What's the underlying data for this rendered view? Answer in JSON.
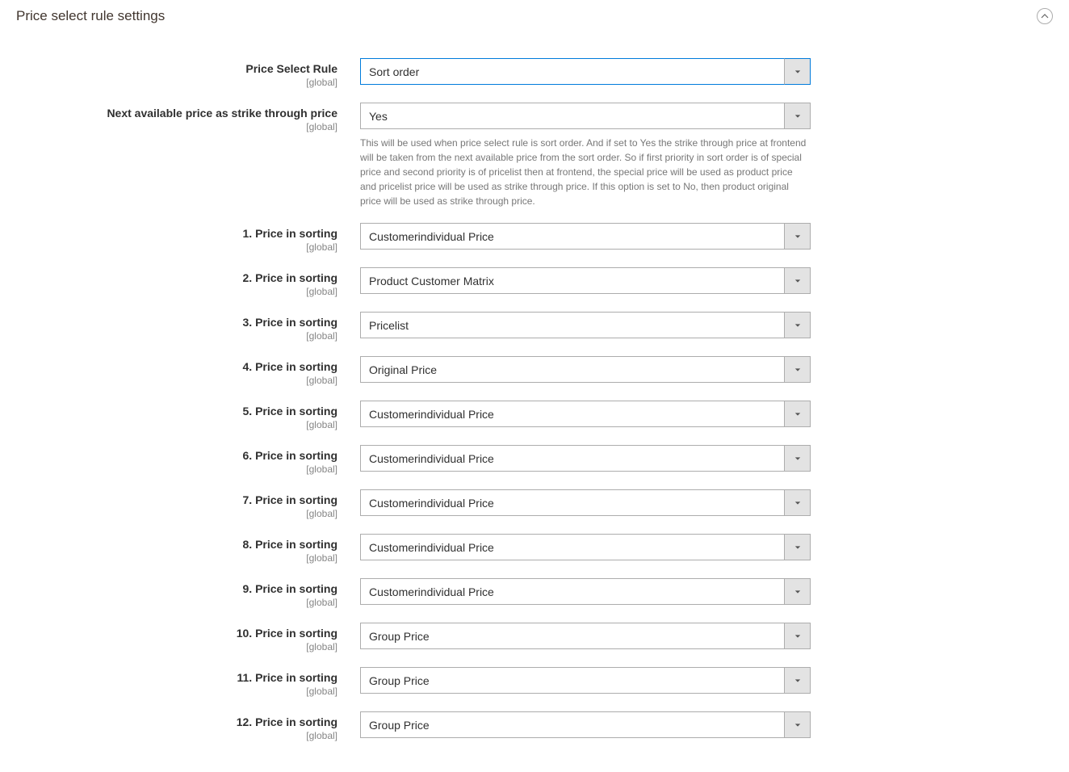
{
  "section": {
    "title": "Price select rule settings"
  },
  "scope": "[global]",
  "fields": {
    "price_select_rule": {
      "label": "Price Select Rule",
      "value": "Sort order"
    },
    "strike_through": {
      "label": "Next available price as strike through price",
      "value": "Yes",
      "help": "This will be used when price select rule is sort order. And if set to Yes the strike through price at frontend will be taken from the next available price from the sort order. So if first priority in sort order is of special price and second priority is of pricelist then at frontend, the special price will be used as product price and pricelist price will be used as strike through price. If this option is set to No, then product original price will be used as strike through price."
    },
    "sorting": [
      {
        "label": "1. Price in sorting",
        "value": "Customerindividual Price"
      },
      {
        "label": "2. Price in sorting",
        "value": "Product Customer Matrix"
      },
      {
        "label": "3. Price in sorting",
        "value": "Pricelist"
      },
      {
        "label": "4. Price in sorting",
        "value": "Original Price"
      },
      {
        "label": "5. Price in sorting",
        "value": "Customerindividual Price"
      },
      {
        "label": "6. Price in sorting",
        "value": "Customerindividual Price"
      },
      {
        "label": "7. Price in sorting",
        "value": "Customerindividual Price"
      },
      {
        "label": "8. Price in sorting",
        "value": "Customerindividual Price"
      },
      {
        "label": "9. Price in sorting",
        "value": "Customerindividual Price"
      },
      {
        "label": "10. Price in sorting",
        "value": "Group Price"
      },
      {
        "label": "11. Price in sorting",
        "value": "Group Price"
      },
      {
        "label": "12. Price in sorting",
        "value": "Group Price"
      }
    ]
  }
}
